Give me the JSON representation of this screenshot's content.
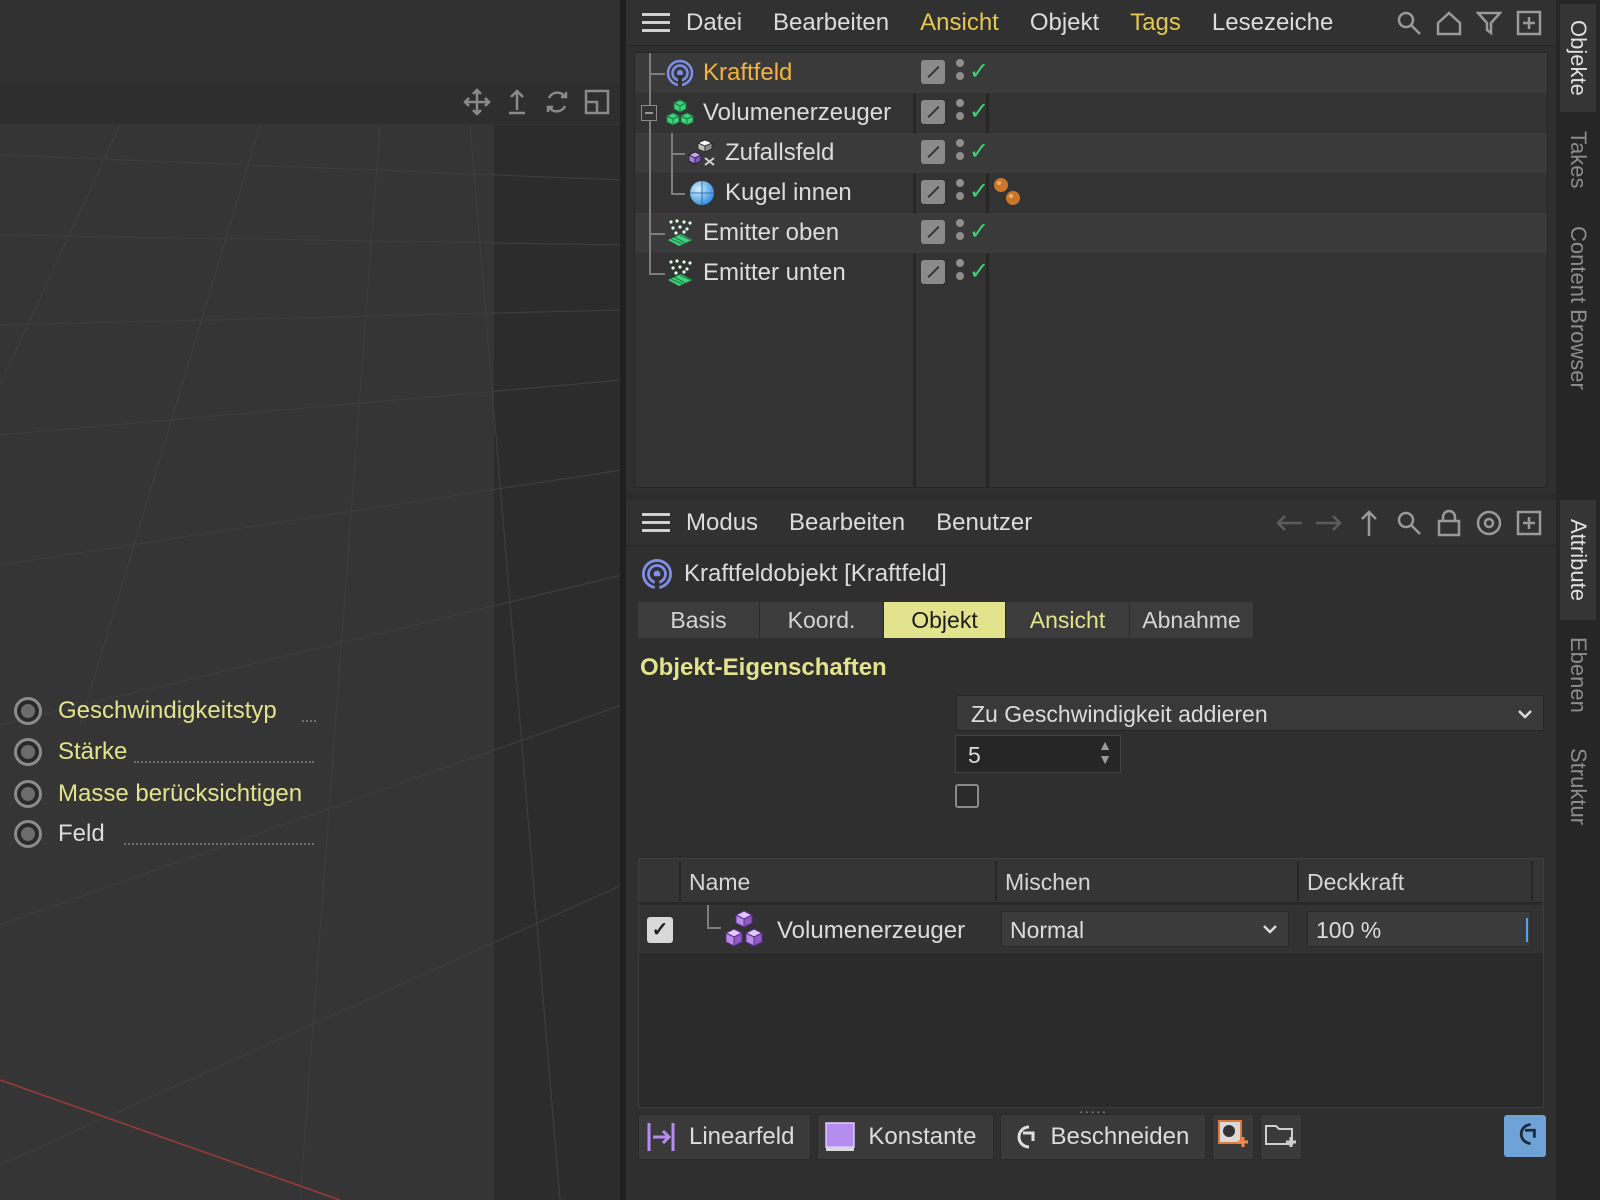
{
  "objects_panel": {
    "menu": [
      {
        "label": "Datei",
        "highlight": false
      },
      {
        "label": "Bearbeiten",
        "highlight": false
      },
      {
        "label": "Ansicht",
        "highlight": true
      },
      {
        "label": "Objekt",
        "highlight": false
      },
      {
        "label": "Tags",
        "highlight": true
      },
      {
        "label": "Lesezeiche",
        "highlight": false
      }
    ],
    "tree": [
      {
        "name": "Kraftfeld",
        "selected": true,
        "icon": "force-field-icon"
      },
      {
        "name": "Volumenerzeuger",
        "selected": false,
        "icon": "volume-builder-icon"
      },
      {
        "name": "Zufallsfeld",
        "selected": false,
        "icon": "random-field-icon"
      },
      {
        "name": "Kugel innen",
        "selected": false,
        "icon": "sphere-icon"
      },
      {
        "name": "Emitter oben",
        "selected": false,
        "icon": "emitter-icon"
      },
      {
        "name": "Emitter unten",
        "selected": false,
        "icon": "emitter-icon"
      }
    ]
  },
  "attributes_panel": {
    "menu": [
      "Modus",
      "Bearbeiten",
      "Benutzer"
    ],
    "object_title": "Kraftfeldobjekt [Kraftfeld]",
    "tabs": [
      {
        "label": "Basis",
        "state": "normal"
      },
      {
        "label": "Koord.",
        "state": "normal"
      },
      {
        "label": "Objekt",
        "state": "active"
      },
      {
        "label": "Ansicht",
        "state": "highlight"
      },
      {
        "label": "Abnahme",
        "state": "normal"
      }
    ],
    "section_title": "Objekt-Eigenschaften",
    "properties": {
      "velocity_type_label": "Geschwindigkeitstyp",
      "velocity_type_value": "Zu Geschwindigkeit addieren",
      "strength_label": "Stärke",
      "strength_value": "5",
      "mass_label": "Masse berücksichtigen",
      "mass_checked": false,
      "field_label": "Feld"
    },
    "field_list": {
      "columns": [
        "Name",
        "Mischen",
        "Deckkraft"
      ],
      "rows": [
        {
          "enabled": true,
          "name": "Volumenerzeuger",
          "mix": "Normal",
          "opacity": "100 %"
        }
      ]
    },
    "field_buttons": [
      "Linearfeld",
      "Konstante",
      "Beschneiden"
    ]
  },
  "side_tabs": [
    "Objekte",
    "Takes",
    "Content Browser",
    "Attribute",
    "Ebenen",
    "Struktur"
  ],
  "colors": {
    "accent_yellow": "#e3e38d",
    "selected_orange": "#f3b33d",
    "check_green": "#3fd27a"
  }
}
